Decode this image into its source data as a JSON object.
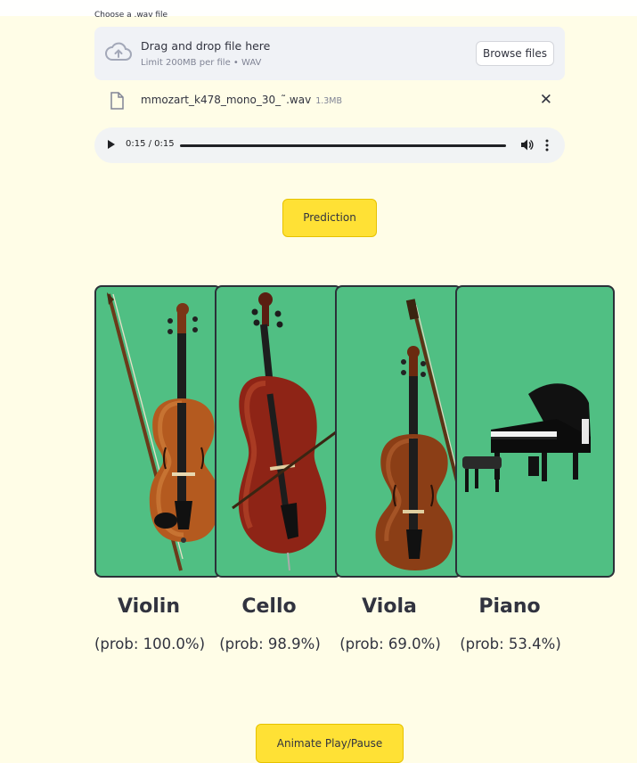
{
  "uploader": {
    "label": "Choose a .wav file",
    "dropzone_title": "Drag and drop file here",
    "dropzone_limit": "Limit 200MB per file • WAV",
    "browse_label": "Browse files"
  },
  "file": {
    "name": "mmozart_k478_mono_30_˜.wav",
    "size": "1.3MB"
  },
  "audio": {
    "time": "0:15 / 0:15",
    "progress": 1.0
  },
  "buttons": {
    "prediction": "Prediction",
    "animate": "Animate Play/Pause"
  },
  "results": [
    {
      "name": "Violin",
      "prob": "(prob: 100.0%)"
    },
    {
      "name": "Cello",
      "prob": "(prob: 98.9%)"
    },
    {
      "name": "Viola",
      "prob": "(prob: 69.0%)"
    },
    {
      "name": "Piano",
      "prob": "(prob: 53.4%)"
    }
  ],
  "colors": {
    "page_bg": "#fffde7",
    "card_bg": "#50bf83",
    "button_bg": "#ffe135",
    "wood": "#a0522d"
  },
  "icons": [
    "cloud-upload-icon",
    "file-icon",
    "close-icon",
    "play-icon",
    "volume-icon",
    "more-options-icon"
  ]
}
